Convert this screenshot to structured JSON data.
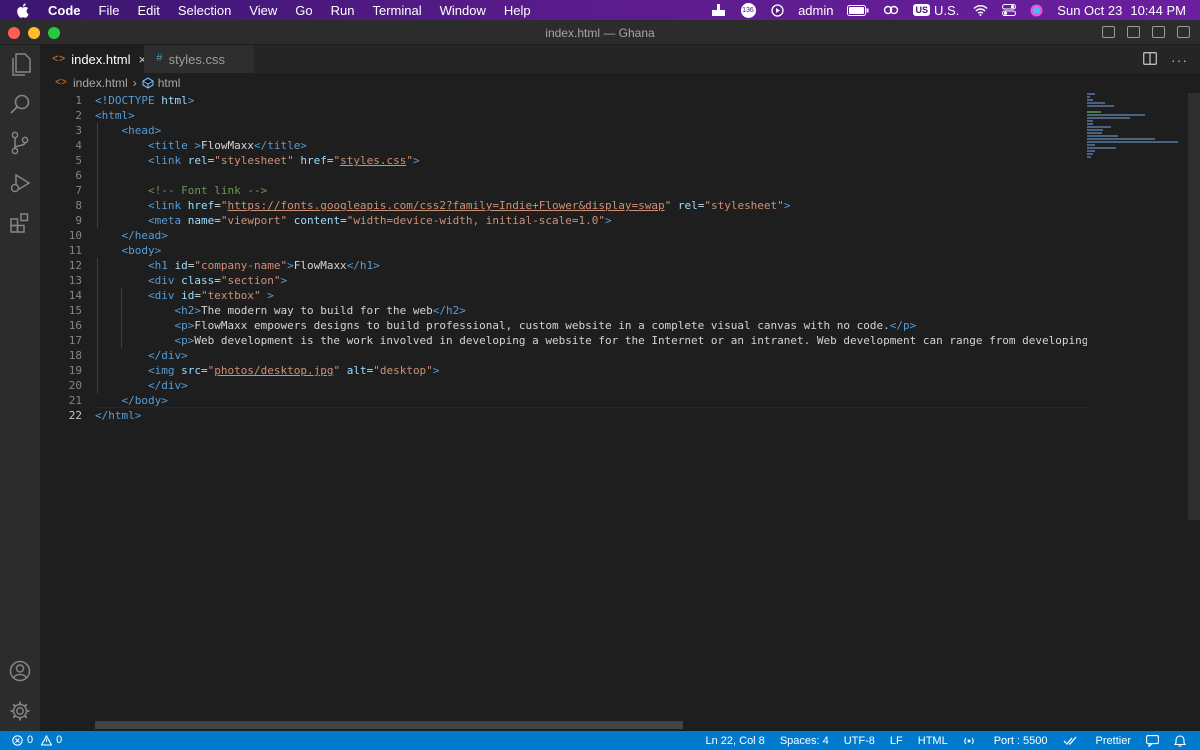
{
  "menubar": {
    "app": "Code",
    "items": [
      "File",
      "Edit",
      "Selection",
      "View",
      "Go",
      "Run",
      "Terminal",
      "Window",
      "Help"
    ],
    "notif_count": "136",
    "user": "admin",
    "input_badge": "US",
    "input_label": "U.S.",
    "date": "Sun Oct 23",
    "time": "10:44 PM"
  },
  "window": {
    "title": "index.html — Ghana"
  },
  "tabs": [
    {
      "label": "index.html",
      "icon": "<>",
      "close": "×"
    },
    {
      "label": "styles.css",
      "icon": "#"
    }
  ],
  "breadcrumb": {
    "file": "index.html",
    "sep": "›",
    "node": "html"
  },
  "editor": {
    "line_numbers": [
      "1",
      "2",
      "3",
      "4",
      "5",
      "6",
      "7",
      "8",
      "9",
      "10",
      "11",
      "12",
      "13",
      "14",
      "15",
      "16",
      "17",
      "18",
      "19",
      "20",
      "21",
      "22"
    ],
    "current_line": "22",
    "lines": [
      [
        [
          "tg",
          "<!DOCTYPE "
        ],
        [
          "at",
          "html"
        ],
        [
          "tg",
          ">"
        ]
      ],
      [
        [
          "tg",
          "<html>"
        ]
      ],
      [
        [
          "tx",
          "    "
        ],
        [
          "tg",
          "<head>"
        ]
      ],
      [
        [
          "tx",
          "        "
        ],
        [
          "tg",
          "<title "
        ],
        [
          "tg",
          ">"
        ],
        [
          "tx",
          "FlowMaxx"
        ],
        [
          "tg",
          "</title>"
        ]
      ],
      [
        [
          "tx",
          "        "
        ],
        [
          "tg",
          "<link "
        ],
        [
          "at",
          "rel"
        ],
        [
          "tx",
          "="
        ],
        [
          "av",
          "\"stylesheet\""
        ],
        [
          "tx",
          " "
        ],
        [
          "at",
          "href"
        ],
        [
          "tx",
          "="
        ],
        [
          "av",
          "\""
        ],
        [
          "avu",
          "styles.css"
        ],
        [
          "av",
          "\""
        ],
        [
          "tg",
          ">"
        ]
      ],
      [
        [
          "tx",
          ""
        ]
      ],
      [
        [
          "tx",
          "        "
        ],
        [
          "cm",
          "<!-- Font link -->"
        ]
      ],
      [
        [
          "tx",
          "        "
        ],
        [
          "tg",
          "<link "
        ],
        [
          "at",
          "href"
        ],
        [
          "tx",
          "="
        ],
        [
          "av",
          "\""
        ],
        [
          "avu",
          "https://fonts.googleapis.com/css2?family=Indie+Flower&display=swap"
        ],
        [
          "av",
          "\""
        ],
        [
          "tx",
          " "
        ],
        [
          "at",
          "rel"
        ],
        [
          "tx",
          "="
        ],
        [
          "av",
          "\"stylesheet\""
        ],
        [
          "tg",
          ">"
        ]
      ],
      [
        [
          "tx",
          "        "
        ],
        [
          "tg",
          "<meta "
        ],
        [
          "at",
          "name"
        ],
        [
          "tx",
          "="
        ],
        [
          "av",
          "\"viewport\""
        ],
        [
          "tx",
          " "
        ],
        [
          "at",
          "content"
        ],
        [
          "tx",
          "="
        ],
        [
          "av",
          "\"width=device-width, initial-scale=1.0\""
        ],
        [
          "tg",
          ">"
        ]
      ],
      [
        [
          "tx",
          "    "
        ],
        [
          "tg",
          "</head>"
        ]
      ],
      [
        [
          "tx",
          "    "
        ],
        [
          "tg",
          "<body>"
        ]
      ],
      [
        [
          "tx",
          "        "
        ],
        [
          "tg",
          "<h1 "
        ],
        [
          "at",
          "id"
        ],
        [
          "tx",
          "="
        ],
        [
          "av",
          "\"company-name\""
        ],
        [
          "tg",
          ">"
        ],
        [
          "tx",
          "FlowMaxx"
        ],
        [
          "tg",
          "</h1>"
        ]
      ],
      [
        [
          "tx",
          "        "
        ],
        [
          "tg",
          "<div "
        ],
        [
          "at",
          "class"
        ],
        [
          "tx",
          "="
        ],
        [
          "av",
          "\"section\""
        ],
        [
          "tg",
          ">"
        ]
      ],
      [
        [
          "tx",
          "        "
        ],
        [
          "tg",
          "<div "
        ],
        [
          "at",
          "id"
        ],
        [
          "tx",
          "="
        ],
        [
          "av",
          "\"textbox\""
        ],
        [
          "tx",
          " "
        ],
        [
          "tg",
          ">"
        ]
      ],
      [
        [
          "tx",
          "            "
        ],
        [
          "tg",
          "<h2>"
        ],
        [
          "tx",
          "The modern way to build for the web"
        ],
        [
          "tg",
          "</h2>"
        ]
      ],
      [
        [
          "tx",
          "            "
        ],
        [
          "tg",
          "<p>"
        ],
        [
          "tx",
          "FlowMaxx empowers designs to build professional, custom website in a complete visual canvas with no code."
        ],
        [
          "tg",
          "</p>"
        ]
      ],
      [
        [
          "tx",
          "            "
        ],
        [
          "tg",
          "<p>"
        ],
        [
          "tx",
          "Web development is the work involved in developing a website for the Internet or an intranet. Web development can range from developing a simple singl"
        ]
      ],
      [
        [
          "tx",
          "        "
        ],
        [
          "tg",
          "</div>"
        ]
      ],
      [
        [
          "tx",
          "        "
        ],
        [
          "tg",
          "<img "
        ],
        [
          "at",
          "src"
        ],
        [
          "tx",
          "="
        ],
        [
          "av",
          "\""
        ],
        [
          "avu",
          "photos/desktop.jpg"
        ],
        [
          "av",
          "\""
        ],
        [
          "tx",
          " "
        ],
        [
          "at",
          "alt"
        ],
        [
          "tx",
          "="
        ],
        [
          "av",
          "\"desktop\""
        ],
        [
          "tg",
          ">"
        ]
      ],
      [
        [
          "tx",
          "        "
        ],
        [
          "tg",
          "</div>"
        ]
      ],
      [
        [
          "tx",
          "    "
        ],
        [
          "tg",
          "</body>"
        ]
      ],
      [
        [
          "tg",
          "</html>"
        ]
      ]
    ]
  },
  "status": {
    "errors": "0",
    "warnings": "0",
    "position": "Ln 22, Col 8",
    "spaces": "Spaces: 4",
    "encoding": "UTF-8",
    "eol": "LF",
    "language": "HTML",
    "port": "Port : 5500",
    "formatter": "Prettier"
  },
  "colors": {
    "accent": "#007acc",
    "tag": "#569cd6",
    "attr": "#9cdcfe",
    "string": "#ce9178",
    "comment": "#6a9955"
  }
}
